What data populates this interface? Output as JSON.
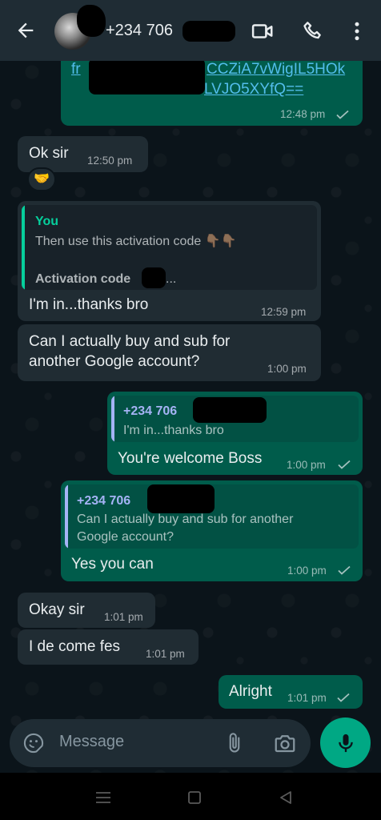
{
  "header": {
    "contact_name": "+234 706",
    "icons": [
      "back-arrow-icon",
      "video-call-icon",
      "phone-icon",
      "more-options-icon"
    ]
  },
  "messages": {
    "m0": {
      "link_line1": "fr",
      "link_line1b": "CCZiA7vWigIL5HOk",
      "link_line2": "LVJO5XYfQ==",
      "time": "12:48 pm"
    },
    "m1": {
      "text": "Ok sir",
      "time": "12:50 pm",
      "reaction": "🤝"
    },
    "m2": {
      "quote_name": "You",
      "quote_text": "Then use this activation code 👇🏽👇🏽",
      "quote_text2": "Activation code",
      "quote_text2b": "...",
      "text": "I'm in...thanks bro",
      "time": "12:59 pm"
    },
    "m3": {
      "text_line1": "Can I actually buy and sub for",
      "text_line2": "another Google account?",
      "time": "1:00 pm"
    },
    "m4": {
      "quote_name": "+234 706",
      "quote_text": "I'm in...thanks bro",
      "text": "You're welcome Boss",
      "time": "1:00 pm"
    },
    "m5": {
      "quote_name": "+234 706",
      "quote_text1": "Can I actually buy and sub for another",
      "quote_text2": "Google account?",
      "text": "Yes you can",
      "time": "1:00 pm"
    },
    "m6": {
      "text": "Okay sir",
      "time": "1:01 pm"
    },
    "m7": {
      "text": "I de come fes",
      "time": "1:01 pm"
    },
    "m8": {
      "text": "Alright",
      "time": "1:01 pm"
    }
  },
  "input": {
    "placeholder": "Message"
  },
  "colors": {
    "header_bg": "#1f2c34",
    "incoming_bubble": "#202c33",
    "outgoing_bubble": "#005c4b",
    "accent_green": "#00a884",
    "you_quote": "#06cf9c",
    "contact_quote": "#a5b3f5",
    "link": "#53bdeb"
  }
}
